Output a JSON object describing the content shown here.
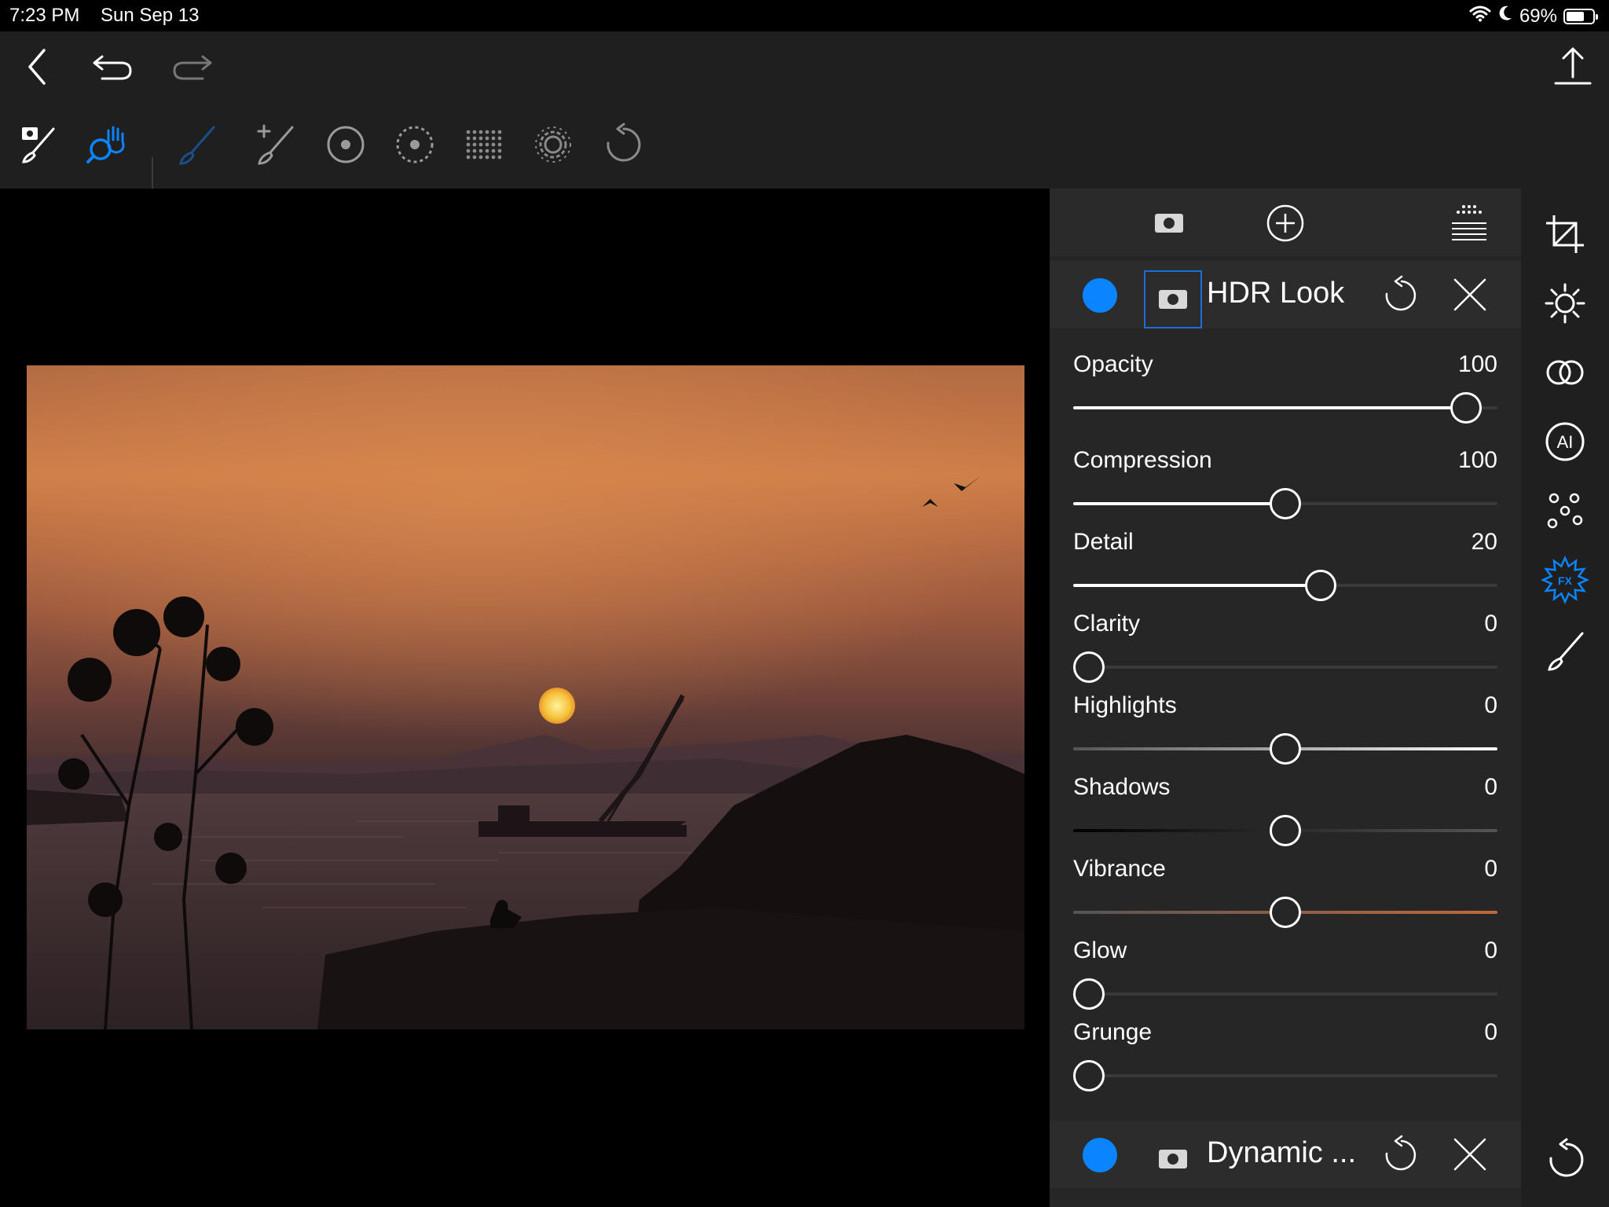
{
  "status": {
    "time": "7:23 PM",
    "date": "Sun Sep 13",
    "battery": "69%",
    "battery_level": 0.69
  },
  "top_bar": {
    "nav": [
      {
        "icon": "back-chevron-icon"
      },
      {
        "icon": "undo-icon"
      },
      {
        "icon": "redo-icon"
      },
      {
        "icon": "share-export-icon"
      }
    ],
    "tools": [
      {
        "icon": "mask-brush-icon",
        "state": "normal"
      },
      {
        "icon": "zoom-pan-hand-icon",
        "state": "active"
      },
      {
        "icon": "brush-icon",
        "state": "accent-dim"
      },
      {
        "icon": "add-brush-icon",
        "state": "normal"
      },
      {
        "icon": "radial-gradient-icon",
        "state": "normal"
      },
      {
        "icon": "radial-feather-icon",
        "state": "normal"
      },
      {
        "icon": "dot-grid-icon",
        "state": "normal"
      },
      {
        "icon": "settings-gear-icon",
        "state": "normal"
      },
      {
        "icon": "reset-rotate-icon",
        "state": "normal"
      }
    ]
  },
  "colors": {
    "accent": "#0a84ff",
    "panel": "#262626",
    "background": "#1f1f1f",
    "vibrance": "#c0683a"
  },
  "panel": {
    "header_icons": [
      "mask-icon",
      "add-layer-icon",
      "layer-stack-icon"
    ],
    "layers": [
      {
        "name": "HDR Look",
        "enabled": true,
        "selected_mask": true
      },
      {
        "name": "Dynamic ...",
        "enabled": true,
        "selected_mask": false
      }
    ],
    "sliders": [
      {
        "label": "Opacity",
        "value": "100",
        "position": 0.96,
        "style": "fill-left"
      },
      {
        "label": "Compression",
        "value": "100",
        "position": 0.5,
        "style": "fill-left"
      },
      {
        "label": "Detail",
        "value": "20",
        "position": 0.59,
        "style": "fill-left"
      },
      {
        "label": "Clarity",
        "value": "0",
        "position": 0.0,
        "style": "fill-left"
      },
      {
        "label": "Highlights",
        "value": "0",
        "position": 0.5,
        "style": "gradient-light"
      },
      {
        "label": "Shadows",
        "value": "0",
        "position": 0.5,
        "style": "gradient-dark"
      },
      {
        "label": "Vibrance",
        "value": "0",
        "position": 0.5,
        "style": "gradient-vibrance"
      },
      {
        "label": "Glow",
        "value": "0",
        "position": 0.0,
        "style": "fill-left"
      },
      {
        "label": "Grunge",
        "value": "0",
        "position": 0.0,
        "style": "fill-left"
      }
    ]
  },
  "right_rail": {
    "icons": [
      "crop-icon",
      "light-adjust-icon",
      "color-icon",
      "ai-icon",
      "details-dots-icon",
      "fx-effects-icon",
      "retouch-brush-icon"
    ],
    "active": "fx-effects-icon",
    "bottom_icon": "reset-icon"
  }
}
